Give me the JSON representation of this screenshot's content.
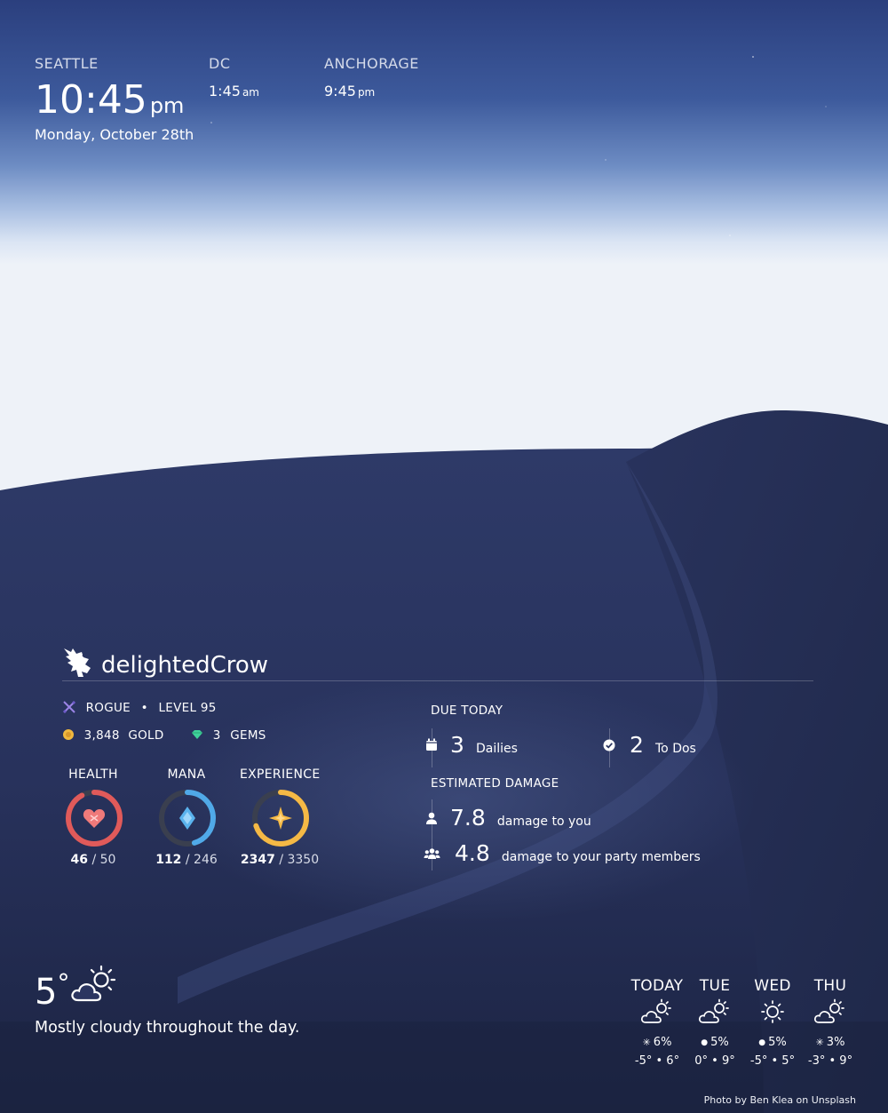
{
  "clocks": [
    {
      "city": "SEATTLE",
      "time": "10:45",
      "ampm": "pm",
      "date": "Monday, October 28th"
    },
    {
      "city": "DC",
      "time": "1:45",
      "ampm": "am"
    },
    {
      "city": "ANCHORAGE",
      "time": "9:45",
      "ampm": "pm"
    }
  ],
  "profile": {
    "username": "delightedCrow",
    "class": "ROGUE",
    "level": "LEVEL 95",
    "gold": "3,848",
    "gold_label": "GOLD",
    "gems": "3",
    "gems_label": "GEMS",
    "stats": [
      {
        "title": "HEALTH",
        "current": "46",
        "max": "/ 50",
        "fraction": 0.92,
        "color": "#e05a5a"
      },
      {
        "title": "MANA",
        "current": "112",
        "max": "/ 246",
        "fraction": 0.455,
        "color": "#50a9e8"
      },
      {
        "title": "EXPERIENCE",
        "current": "2347",
        "max": "/ 3350",
        "fraction": 0.7,
        "color": "#f5b945"
      }
    ]
  },
  "due_today": {
    "heading": "DUE TODAY",
    "dailies_count": "3",
    "dailies_label": "Dailies",
    "todos_count": "2",
    "todos_label": "To Dos"
  },
  "damage": {
    "heading": "ESTIMATED DAMAGE",
    "you_value": "7.8",
    "you_label": "damage to you",
    "party_value": "4.8",
    "party_label": "damage to your party members"
  },
  "weather": {
    "temp": "5",
    "degree": "°",
    "icon": "partly-cloudy-icon",
    "summary": "Mostly cloudy throughout the day.",
    "forecast": [
      {
        "day": "TODAY",
        "icon": "partly-cloudy-icon",
        "precip_icon": "snow-icon",
        "precip": "6%",
        "range": "-5° • 6°"
      },
      {
        "day": "TUE",
        "icon": "partly-cloudy-icon",
        "precip_icon": "rain-drop-icon",
        "precip": "5%",
        "range": "0° • 9°"
      },
      {
        "day": "WED",
        "icon": "sun-icon",
        "precip_icon": "rain-drop-icon",
        "precip": "5%",
        "range": "-5° • 5°"
      },
      {
        "day": "THU",
        "icon": "partly-cloudy-icon",
        "precip_icon": "snow-icon",
        "precip": "3%",
        "range": "-3° • 9°"
      }
    ]
  },
  "credit": "Photo by Ben Klea on Unsplash"
}
